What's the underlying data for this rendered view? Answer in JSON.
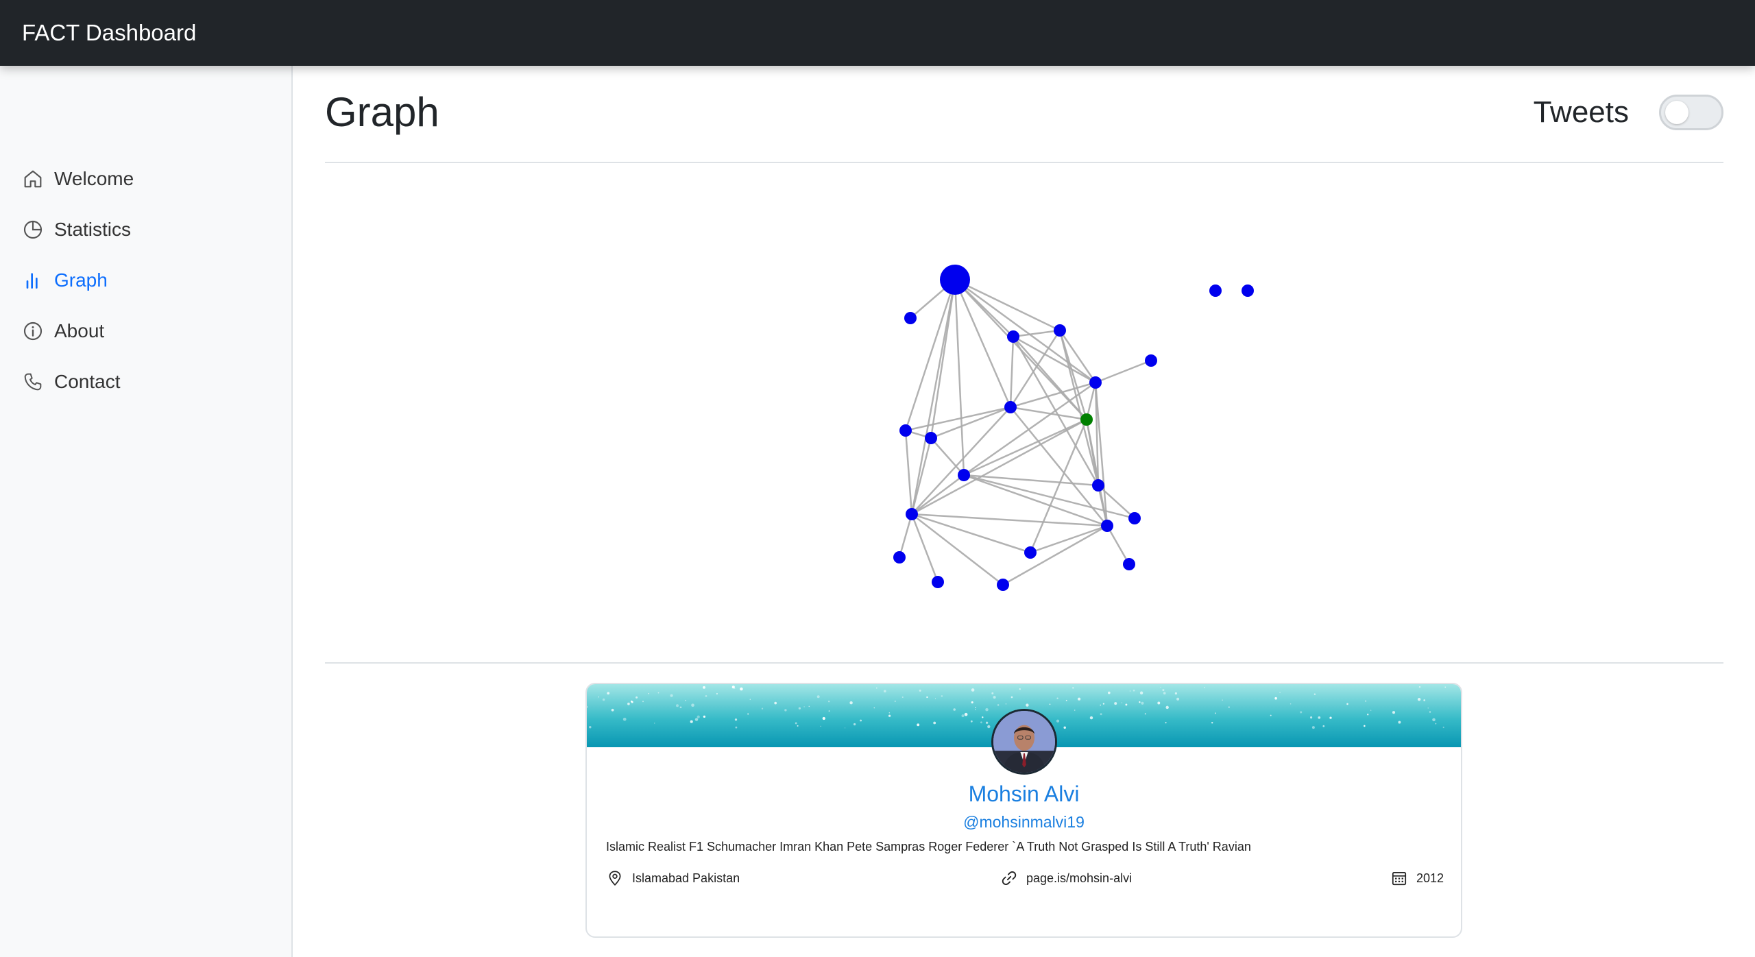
{
  "app": {
    "title": "FACT Dashboard"
  },
  "sidebar": {
    "items": [
      {
        "label": "Welcome",
        "icon": "house-icon",
        "active": false
      },
      {
        "label": "Statistics",
        "icon": "pie-chart-icon",
        "active": false
      },
      {
        "label": "Graph",
        "icon": "bar-chart-icon",
        "active": true
      },
      {
        "label": "About",
        "icon": "info-icon",
        "active": false
      },
      {
        "label": "Contact",
        "icon": "phone-icon",
        "active": false
      }
    ]
  },
  "header": {
    "title": "Graph",
    "toggle_label": "Tweets",
    "toggle_on": false
  },
  "graph": {
    "node_color": "#0000ee",
    "highlight_color": "#008000",
    "edge_color": "#aaaaaa"
  },
  "profile": {
    "name": "Mohsin Alvi",
    "handle": "@mohsinmalvi19",
    "bio": "Islamic Realist F1 Schumacher Imran Khan Pete Sampras Roger Federer `A Truth Not Grasped Is Still A Truth' Ravian",
    "location": "Islamabad Pakistan",
    "website": "page.is/mohsin-alvi",
    "joined": "2012",
    "accent_color": "#1a7fe0"
  }
}
